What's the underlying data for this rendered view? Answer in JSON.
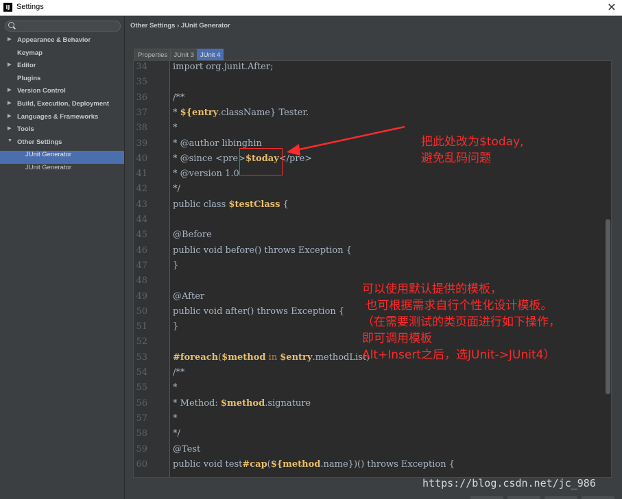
{
  "window": {
    "title": "Settings",
    "close_glyph": "✕",
    "app_icon": "IJ"
  },
  "search": {
    "placeholder": "",
    "value": ""
  },
  "sidebar": {
    "items": [
      {
        "label": "Appearance & Behavior",
        "arrow": "▶"
      },
      {
        "label": "Keymap",
        "arrow": ""
      },
      {
        "label": "Editor",
        "arrow": "▶"
      },
      {
        "label": "Plugins",
        "arrow": ""
      },
      {
        "label": "Version Control",
        "arrow": "▶"
      },
      {
        "label": "Build, Execution, Deployment",
        "arrow": "▶"
      },
      {
        "label": "Languages & Frameworks",
        "arrow": "▶"
      },
      {
        "label": "Tools",
        "arrow": "▶"
      },
      {
        "label": "Other Settings",
        "arrow": "▼"
      },
      {
        "label": "JUnit Generator",
        "arrow": ""
      },
      {
        "label": "JUnit Generator",
        "arrow": ""
      }
    ]
  },
  "breadcrumb": {
    "part1": "Other Settings",
    "sep": "›",
    "part2": "JUnit Generator"
  },
  "tabs": [
    {
      "label": "Properties"
    },
    {
      "label": "JUnit 3"
    },
    {
      "label": "JUnit 4"
    }
  ],
  "editor": {
    "lines": [
      {
        "n": "34",
        "t": "import org.junit.After;"
      },
      {
        "n": "35",
        "t": ""
      },
      {
        "n": "36",
        "t": "/**"
      },
      {
        "n": "37",
        "t": "* ${entry.className} Tester."
      },
      {
        "n": "38",
        "t": "*"
      },
      {
        "n": "39",
        "t": "* @author libinghin"
      },
      {
        "n": "40",
        "t": "* @since <pre>$today</pre>"
      },
      {
        "n": "41",
        "t": "* @version 1.0"
      },
      {
        "n": "42",
        "t": "*/"
      },
      {
        "n": "43",
        "t": "public class $testClass {"
      },
      {
        "n": "44",
        "t": ""
      },
      {
        "n": "45",
        "t": "@Before"
      },
      {
        "n": "46",
        "t": "public void before() throws Exception {"
      },
      {
        "n": "47",
        "t": "}"
      },
      {
        "n": "48",
        "t": ""
      },
      {
        "n": "49",
        "t": "@After"
      },
      {
        "n": "50",
        "t": "public void after() throws Exception {"
      },
      {
        "n": "51",
        "t": "}"
      },
      {
        "n": "52",
        "t": ""
      },
      {
        "n": "53",
        "t": "#foreach($method in $entry.methodList)"
      },
      {
        "n": "54",
        "t": "/**"
      },
      {
        "n": "55",
        "t": "*"
      },
      {
        "n": "56",
        "t": "* Method: $method.signature"
      },
      {
        "n": "57",
        "t": "*"
      },
      {
        "n": "58",
        "t": "*/"
      },
      {
        "n": "59",
        "t": "@Test"
      },
      {
        "n": "60",
        "t": "public void test#cap(${method.name})() throws Exception {"
      }
    ]
  },
  "annotations": {
    "top": "把此处改为$today,\n避免乱码问题",
    "middle": "可以使用默认提供的模板，\n 也可根据需求自行个性化设计模板。\n（在需要测试的类页面进行如下操作，\n即可调用模板\nAlt+Insert之后，选JUnit->JUnit4）"
  },
  "watermark": "https://blog.csdn.net/jc_986",
  "colors": {
    "annotation": "#ff2a2a",
    "selection": "#4b6eaf",
    "editor_bg": "#2b2b2b",
    "variable": "#e8bf6a"
  }
}
